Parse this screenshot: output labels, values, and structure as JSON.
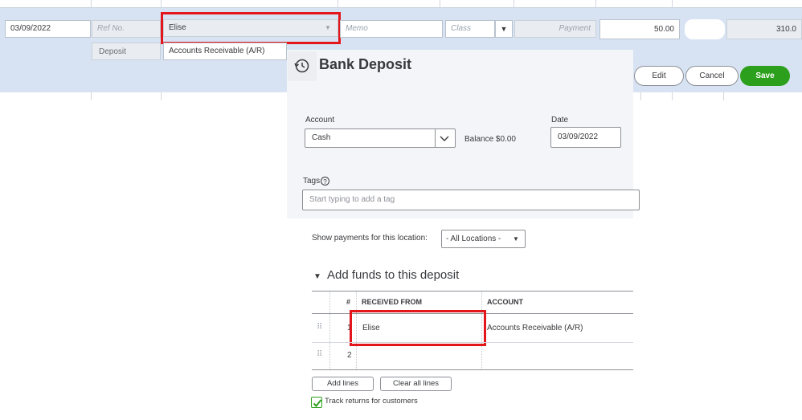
{
  "register": {
    "date": "03/09/2022",
    "ref_no_placeholder": "Ref No.",
    "payee": "Elise",
    "memo_placeholder": "Memo",
    "class_placeholder": "Class",
    "payment_placeholder": "Payment",
    "amount": "50.00",
    "balance": "310.0",
    "type_label": "Deposit",
    "account": "Accounts Receivable (A/R)",
    "edit_label": "Edit",
    "cancel_label": "Cancel",
    "save_label": "Save"
  },
  "dialog": {
    "title": "Bank Deposit",
    "account_label": "Account",
    "account_value": "Cash",
    "balance_text": "Balance $0.00",
    "date_label": "Date",
    "date_value": "03/09/2022",
    "tags_label": "Tags",
    "tags_help": "?",
    "tags_placeholder": "Start typing to add a tag",
    "location_label": "Show payments for this location:",
    "location_value": "- All Locations -",
    "section_title": "Add funds to this deposit",
    "columns": [
      "#",
      "RECEIVED FROM",
      "ACCOUNT"
    ],
    "rows": [
      {
        "num": "1",
        "received_from": "Elise",
        "account": "Accounts Receivable (A/R)"
      },
      {
        "num": "2",
        "received_from": "",
        "account": ""
      }
    ],
    "add_lines_label": "Add lines",
    "clear_lines_label": "Clear all lines",
    "track_returns_label": "Track returns for customers"
  }
}
